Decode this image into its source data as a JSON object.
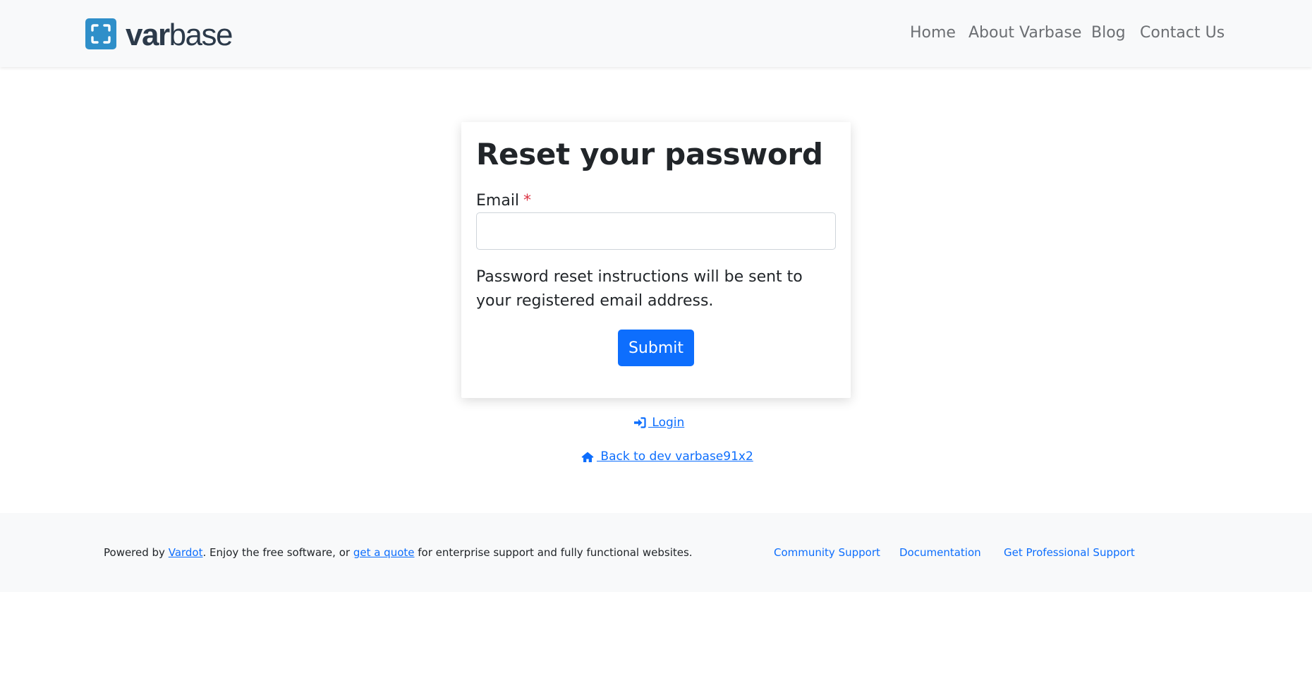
{
  "header": {
    "logo": {
      "bold": "var",
      "light": "base",
      "icon": "varbase-logo-icon"
    },
    "nav": [
      {
        "label": "Home"
      },
      {
        "label": "About Varbase"
      },
      {
        "label": "Blog"
      },
      {
        "label": "Contact Us"
      }
    ]
  },
  "form": {
    "title": "Reset your password",
    "email_label": "Email",
    "required_marker": "*",
    "email_value": "",
    "help_text": "Password reset instructions will be sent to your registered email address.",
    "submit_label": "Submit"
  },
  "links": {
    "login": {
      "label": " Login",
      "icon": "sign-in-icon"
    },
    "back": {
      "label": " Back to dev varbase91x2",
      "icon": "home-icon"
    }
  },
  "footer": {
    "powered_prefix": "Powered by ",
    "vardot_link": "Vardot",
    "middle_text": ". Enjoy the free software, or ",
    "quote_link": "get a quote",
    "suffix_text": " for enterprise support and fully functional websites.",
    "links": [
      {
        "label": "Community Support"
      },
      {
        "label": "Documentation"
      },
      {
        "label": "Get Professional Support"
      }
    ]
  },
  "colors": {
    "primary": "#0d6efd",
    "brand": "#2f8fc9",
    "required": "#dc3545",
    "header_bg": "#f8f9fa"
  }
}
